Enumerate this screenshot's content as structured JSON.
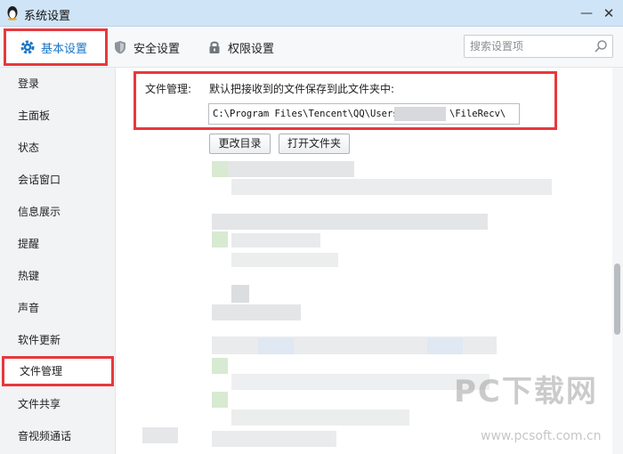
{
  "window": {
    "title": "系统设置"
  },
  "tabs": [
    {
      "label": "基本设置",
      "icon": "gear-icon",
      "active": true
    },
    {
      "label": "安全设置",
      "icon": "shield-icon",
      "active": false
    },
    {
      "label": "权限设置",
      "icon": "lock-icon",
      "active": false
    }
  ],
  "search": {
    "placeholder": "搜索设置项"
  },
  "sidebar": {
    "items": [
      {
        "label": "登录"
      },
      {
        "label": "主面板"
      },
      {
        "label": "状态"
      },
      {
        "label": "会话窗口"
      },
      {
        "label": "信息展示"
      },
      {
        "label": "提醒"
      },
      {
        "label": "热键"
      },
      {
        "label": "声音"
      },
      {
        "label": "软件更新"
      },
      {
        "label": "文件管理",
        "active": true
      },
      {
        "label": "文件共享"
      },
      {
        "label": "音视频通话"
      }
    ]
  },
  "file_management": {
    "label": "文件管理:",
    "description": "默认把接收到的文件保存到此文件夹中:",
    "path_prefix": "C:\\Program Files\\Tencent\\QQ\\Users\\",
    "path_suffix": "\\FileRecv\\",
    "change_button": "更改目录",
    "open_button": "打开文件夹"
  },
  "watermark": {
    "brand": "PC下载网",
    "url": "www.pcsoft.com.cn"
  },
  "colors": {
    "highlight_border": "#e8383d",
    "accent": "#1a75c4",
    "titlebar": "#cfe4f6"
  }
}
